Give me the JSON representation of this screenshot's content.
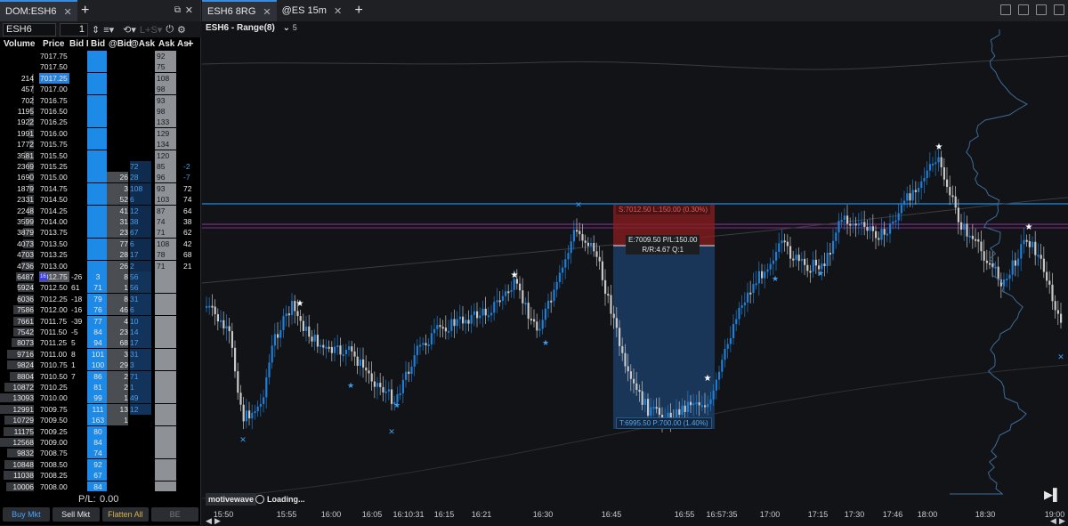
{
  "dom": {
    "tab_label": "DOM:ESH6",
    "symbol": "ESH6",
    "qty": "1",
    "headers": {
      "volume": "Volume",
      "price": "Price",
      "bid_q": "Bid I",
      "bid": "Bid",
      "at_bid": "@Bid",
      "at_ask": "@Ask",
      "ask": "Ask",
      "ask_q": "As"
    },
    "pl_label": "P/L:",
    "pl_value": "0.00",
    "buttons": {
      "buy": "Buy Mkt",
      "sell": "Sell Mkt",
      "flatten": "Flatten All",
      "be": "BE"
    },
    "rows": [
      {
        "v": "",
        "p": "7017.75",
        "a": "92"
      },
      {
        "v": "",
        "p": "7017.50",
        "a": "75"
      },
      {
        "v": "214",
        "p": "7017.25",
        "a": "108",
        "hl": "sel"
      },
      {
        "v": "457",
        "p": "7017.00",
        "a": "98"
      },
      {
        "v": "702",
        "p": "7016.75",
        "a": "93"
      },
      {
        "v": "1195",
        "p": "7016.50",
        "a": "98"
      },
      {
        "v": "1922",
        "p": "7016.25",
        "a": "133"
      },
      {
        "v": "1991",
        "p": "7016.00",
        "a": "129"
      },
      {
        "v": "1772",
        "p": "7015.75",
        "a": "134"
      },
      {
        "v": "3581",
        "p": "7015.50",
        "a": "120"
      },
      {
        "v": "2369",
        "p": "7015.25",
        "ab": "72",
        "a": "85",
        "aq": "-2"
      },
      {
        "v": "1690",
        "p": "7015.00",
        "aa": "26",
        "ab": "28",
        "a": "96",
        "aq": "-7"
      },
      {
        "v": "1879",
        "p": "7014.75",
        "aa": "3",
        "ab": "108",
        "a": "93",
        "aq": "72"
      },
      {
        "v": "2331",
        "p": "7014.50",
        "aa": "52",
        "ab": "6",
        "a": "103",
        "aq": "74"
      },
      {
        "v": "2248",
        "p": "7014.25",
        "aa": "41",
        "ab": "12",
        "a": "87",
        "aq": "64"
      },
      {
        "v": "3599",
        "p": "7014.00",
        "aa": "31",
        "ab": "38",
        "a": "74",
        "aq": "38"
      },
      {
        "v": "3879",
        "p": "7013.75",
        "aa": "23",
        "ab": "67",
        "a": "71",
        "aq": "62"
      },
      {
        "v": "4073",
        "p": "7013.50",
        "aa": "77",
        "ab": "6",
        "a": "108",
        "aq": "42"
      },
      {
        "v": "4703",
        "p": "7013.25",
        "aa": "28",
        "ab": "17",
        "a": "78",
        "aq": "68"
      },
      {
        "v": "4736",
        "p": "7013.00",
        "aa": "26",
        "ab": "2",
        "a": "71",
        "aq": "21"
      },
      {
        "v": "6487",
        "p": "7012.75",
        "bq": "-26",
        "b": "3",
        "aa": "8",
        "ab": "56",
        "hl": "cur",
        "tag": "16"
      },
      {
        "v": "5924",
        "p": "7012.50",
        "bq": "61",
        "b": "71",
        "aa": "1",
        "ab": "56"
      },
      {
        "v": "6036",
        "p": "7012.25",
        "bq": "-18",
        "b": "79",
        "aa": "8",
        "ab": "31"
      },
      {
        "v": "7586",
        "p": "7012.00",
        "bq": "-16",
        "b": "76",
        "aa": "46",
        "ab": "6"
      },
      {
        "v": "7661",
        "p": "7011.75",
        "bq": "-39",
        "b": "77",
        "aa": "4",
        "ab": "10"
      },
      {
        "v": "7542",
        "p": "7011.50",
        "bq": "-5",
        "b": "84",
        "aa": "23",
        "ab": "14"
      },
      {
        "v": "8073",
        "p": "7011.25",
        "bq": "5",
        "b": "94",
        "aa": "68",
        "ab": "17"
      },
      {
        "v": "9716",
        "p": "7011.00",
        "bq": "8",
        "b": "101",
        "aa": "3",
        "ab": "31"
      },
      {
        "v": "9824",
        "p": "7010.75",
        "bq": "1",
        "b": "100",
        "aa": "29",
        "ab": "3"
      },
      {
        "v": "8804",
        "p": "7010.50",
        "bq": "7",
        "b": "86",
        "aa": "2",
        "ab": "71"
      },
      {
        "v": "10872",
        "p": "7010.25",
        "b": "81",
        "aa": "2",
        "ab": "1"
      },
      {
        "v": "13093",
        "p": "7010.00",
        "b": "99",
        "aa": "1",
        "ab": "49"
      },
      {
        "v": "12991",
        "p": "7009.75",
        "b": "111",
        "aa": "13",
        "ab": "12"
      },
      {
        "v": "10729",
        "p": "7009.50",
        "b": "163",
        "aa": "1"
      },
      {
        "v": "11175",
        "p": "7009.25",
        "b": "80"
      },
      {
        "v": "12568",
        "p": "7009.00",
        "b": "84"
      },
      {
        "v": "9832",
        "p": "7008.75",
        "b": "74"
      },
      {
        "v": "10848",
        "p": "7008.50",
        "b": "92"
      },
      {
        "v": "11038",
        "p": "7008.25",
        "b": "67"
      },
      {
        "v": "10006",
        "p": "7008.00",
        "b": "84"
      }
    ]
  },
  "chart": {
    "tabs": [
      "ESH6 8RG",
      "@ES 15m"
    ],
    "title": "ESH6 - Range(8)",
    "title_suffix": "5",
    "stop_label": "S:7012.50 L:150.00 (0.30%)",
    "entry_label": "E:7009.50 P/L:150.00",
    "rr_label": "R/R:4.67 Q:1",
    "target_label": "T:6995.50 P:700.00 (1.40%)",
    "brand": "motivewave",
    "loading": "Loading...",
    "time_labels": [
      "15:50",
      "15:55",
      "16:00",
      "16:05",
      "16:10:31",
      "16:15",
      "16:21",
      "16:30",
      "16:45",
      "16:55",
      "16:57:35",
      "17:00",
      "17:15",
      "17:30",
      "17:46",
      "18:00",
      "18:30",
      "19:00"
    ],
    "colors": {
      "bull": "#1e7fd8",
      "bear": "#c8c8c8",
      "stop": "#8b1e1e",
      "target": "#1b3a5e",
      "level_blue": "#1e8ae8",
      "level_purple": "#7a2f86"
    }
  }
}
